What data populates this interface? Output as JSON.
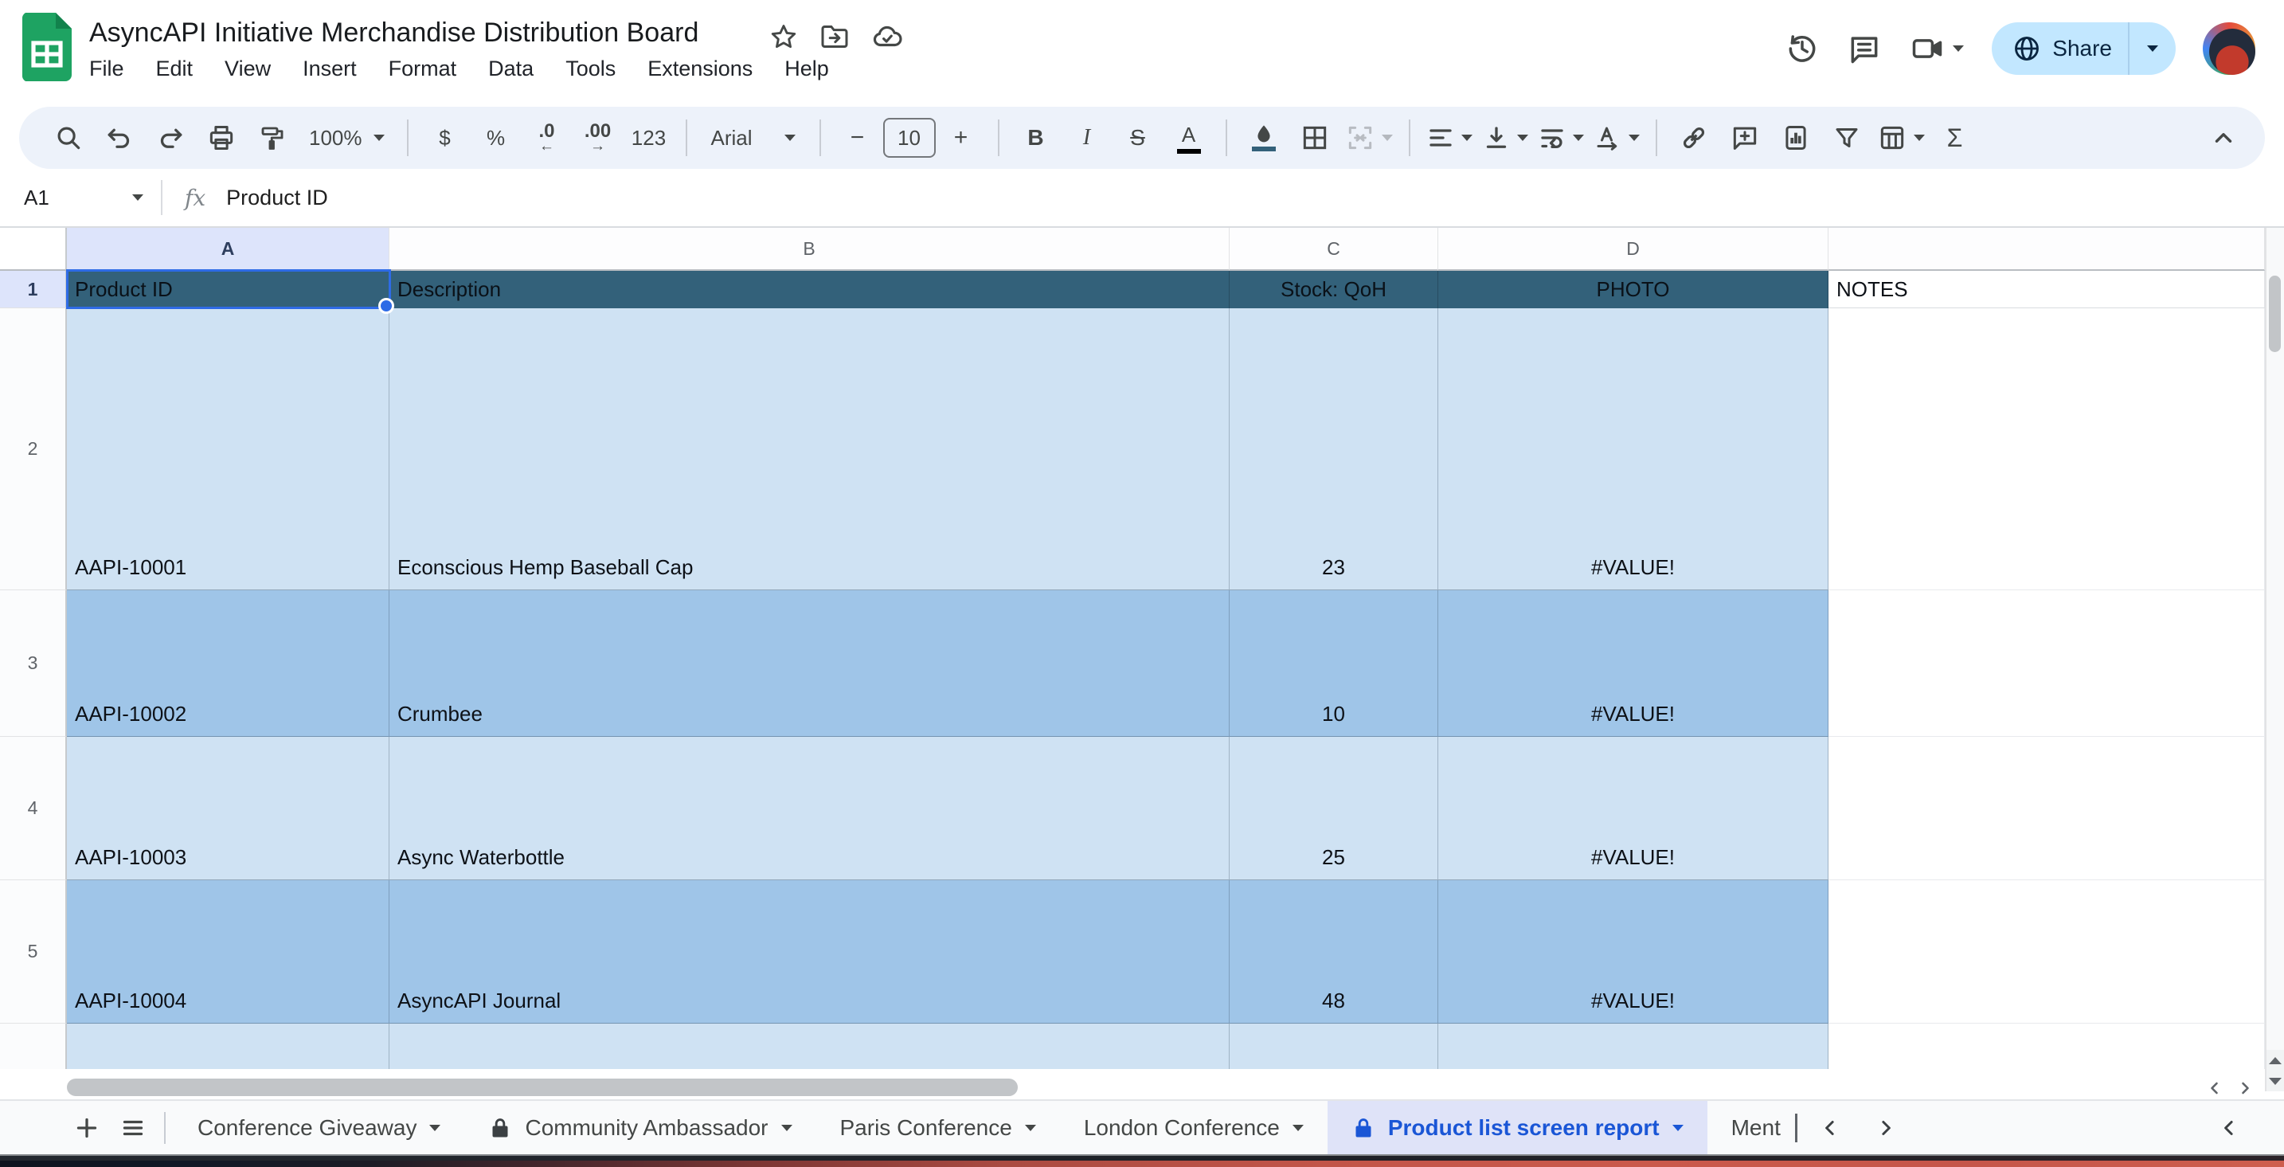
{
  "titlebar": {
    "title": "AsyncAPI Initiative Merchandise Distribution Board",
    "menus": [
      "File",
      "Edit",
      "View",
      "Insert",
      "Format",
      "Data",
      "Tools",
      "Extensions",
      "Help"
    ],
    "share_label": "Share"
  },
  "toolbar": {
    "zoom": "100%",
    "currency": "$",
    "percent": "%",
    "decrease_decimal": ".0",
    "decrease_arrow": "←",
    "increase_decimal": ".00",
    "increase_arrow": "→",
    "number_format": "123",
    "font_name": "Arial",
    "font_size": "10",
    "minus": "−",
    "plus": "+",
    "bold": "B",
    "italic": "I",
    "strikethrough": "S",
    "text_color": "A",
    "functions": "Σ"
  },
  "formula_bar": {
    "name_box": "A1",
    "fx": "fx",
    "content": "Product ID"
  },
  "sheet": {
    "column_headers": [
      "A",
      "B",
      "C",
      "D"
    ],
    "header_row": {
      "row_number": "1",
      "product_id": "Product ID",
      "description": "Description",
      "stock": "Stock: QoH",
      "photo": "PHOTO",
      "notes": "NOTES"
    },
    "rows": [
      {
        "row_number": "2",
        "product_id": "AAPI-10001",
        "description": "Econscious Hemp Baseball Cap",
        "stock": "23",
        "photo": "#VALUE!"
      },
      {
        "row_number": "3",
        "product_id": "AAPI-10002",
        "description": "Crumbee",
        "stock": "10",
        "photo": "#VALUE!"
      },
      {
        "row_number": "4",
        "product_id": "AAPI-10003",
        "description": "Async Waterbottle",
        "stock": "25",
        "photo": "#VALUE!"
      },
      {
        "row_number": "5",
        "product_id": "AAPI-10004",
        "description": "AsyncAPI Journal",
        "stock": "48",
        "photo": "#VALUE!"
      }
    ]
  },
  "sheet_tabs": {
    "tabs": [
      {
        "label": "Conference Giveaway",
        "locked": false,
        "active": false
      },
      {
        "label": "Community Ambassador",
        "locked": true,
        "active": false
      },
      {
        "label": "Paris Conference",
        "locked": false,
        "active": false
      },
      {
        "label": "London Conference",
        "locked": false,
        "active": false
      },
      {
        "label": "Product list screen report",
        "locked": true,
        "active": true
      },
      {
        "label": "Ment",
        "locked": false,
        "active": false,
        "truncated": true
      }
    ]
  },
  "colors": {
    "header_row_teal": "#33617a",
    "band_light_blue": "#cfe2f3",
    "band_medium_blue": "#9fc5e8",
    "selection_blue": "#2e6be6",
    "active_tab_text": "#1a56d6",
    "active_tab_bg": "#dfe3f8",
    "share_button_bg": "#c2e7ff",
    "logo_green": "#1ea362",
    "fill_color_swatch": "#33617a",
    "text_color_swatch": "#000000"
  },
  "icons": {
    "logo": "sheets-grid",
    "star": "☆",
    "move-folder": "folder→",
    "cloud-saved": "cloud✓",
    "history": "clock-ccw",
    "comments": "speech-bubble",
    "video-call": "camera",
    "globe": "🌐",
    "search": "magnifier",
    "undo": "↶",
    "redo": "↷",
    "print": "printer",
    "paint-format": "roller",
    "borders": "grid",
    "merge": "merge-cells",
    "align": "lines",
    "link": "chain",
    "insert-comment": "bubble+",
    "insert-chart": "bars",
    "filter": "funnel",
    "table-views": "table",
    "collapse": "^",
    "lock": "padlock",
    "add-sheet": "+",
    "all-sheets": "≡",
    "caret": "▾"
  }
}
